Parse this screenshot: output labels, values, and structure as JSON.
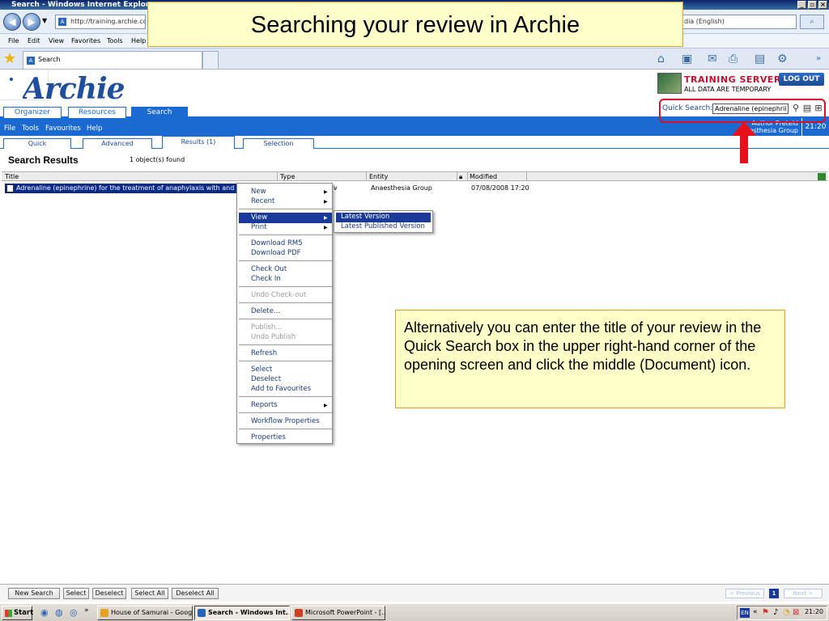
{
  "browser": {
    "title": "Search - Windows Internet Explorer",
    "address": "http://training.archie.cochr",
    "search_box": "dia (English)",
    "menu": [
      "File",
      "Edit",
      "View",
      "Favorites",
      "Tools",
      "Help"
    ],
    "tab_title": "Search"
  },
  "archie": {
    "logo": "Archie",
    "server_title": "TRAINING SERVER",
    "server_sub": "ALL DATA ARE TEMPORARY",
    "logout": "LOG OUT",
    "main_tabs": [
      "Organizer",
      "Resources",
      "Search"
    ],
    "quick_search_label": "Quick Search:",
    "quick_search_value": "Adrenaline (epinephrii",
    "app_menu": [
      "File",
      "Tools",
      "Favourites",
      "Help"
    ],
    "user_line1": "Author Preteid",
    "user_line2": "esthesia Group",
    "time": "21:20",
    "sub_tabs": [
      "Quick",
      "Advanced",
      "Results (1)",
      "Selection"
    ]
  },
  "results": {
    "title": "Search Results",
    "count": "1 object(s) found",
    "columns": [
      "Title",
      "Type",
      "Entity",
      "Modified"
    ],
    "rows": [
      {
        "title": "Adrenaline (epinephrine) for the treatment of anaphylaxis with and without sh",
        "type_suffix": "v",
        "entity": "Anaesthesia Group",
        "modified": "07/08/2008 17:20"
      }
    ]
  },
  "context_menu": {
    "items": [
      "New",
      "Recent",
      "View",
      "Print",
      "Download RM5",
      "Download PDF",
      "Check Out",
      "Check In",
      "Undo Check-out",
      "Delete...",
      "Publish...",
      "Undo Publish",
      "Refresh",
      "Select",
      "Deselect",
      "Add to Favourites",
      "Reports",
      "Workflow Properties",
      "Properties"
    ],
    "submenu": [
      "Latest Version",
      "Latest Published Version"
    ]
  },
  "bottom_buttons": [
    "New Search",
    "Select",
    "Deselect",
    "Select All",
    "Deselect All"
  ],
  "pager": {
    "prev": "< Previous",
    "page": "1",
    "next": "Next >"
  },
  "taskbar": {
    "start": "Start",
    "tasks": [
      "House of Samurai - Goog...",
      "Search - Windows Int...",
      "Microsoft PowerPoint - [..."
    ],
    "clock": "21:20",
    "lang": "EN"
  },
  "slide": {
    "title": "Searching your review in Archie",
    "callout": "Alternatively you can enter the title of your review in the Quick Search box in the upper right-hand corner of the opening screen and click the middle (Document) icon."
  },
  "colors": {
    "accent": "#1a6ad2",
    "highlight": "#1a3a9a",
    "alert": "#d8102a",
    "callout_bg": "#ffffc8"
  }
}
